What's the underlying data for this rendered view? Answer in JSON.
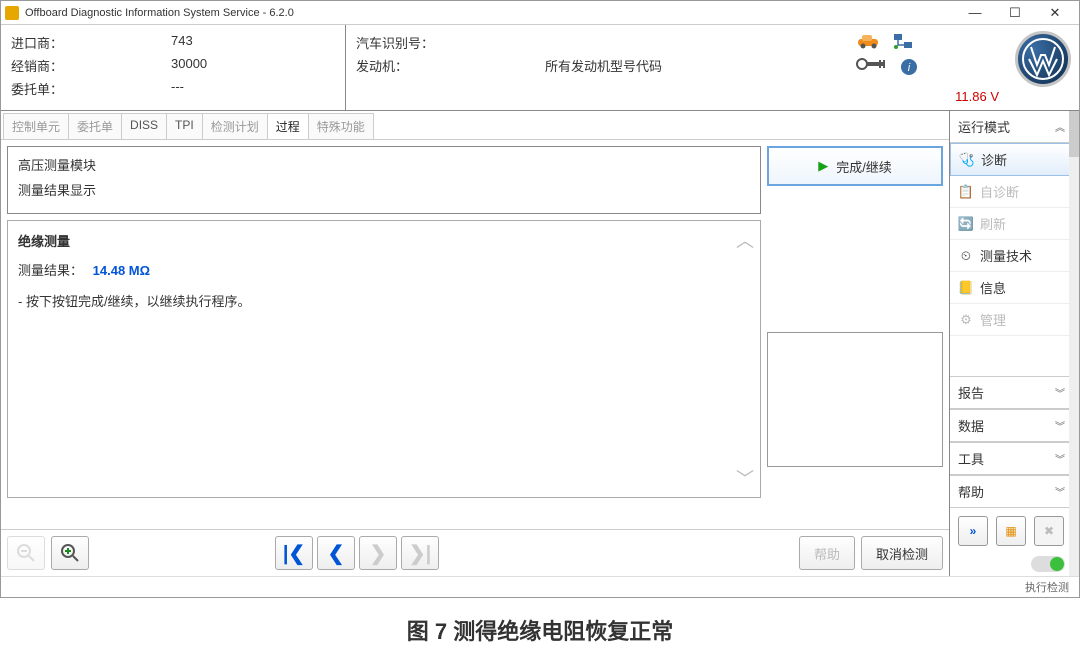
{
  "title": "Offboard Diagnostic Information System Service - 6.2.0",
  "header": {
    "importer_lbl": "进口商：",
    "importer_val": "743",
    "dealer_lbl": "经销商：",
    "dealer_val": "30000",
    "order_lbl": "委托单：",
    "order_val": "---",
    "vin_lbl": "汽车识别号：",
    "vin_val": "",
    "engine_lbl": "发动机：",
    "engine_val": "所有发动机型号代码",
    "voltage": "11.86 V"
  },
  "tabs": {
    "t0": "控制单元",
    "t1": "委托单",
    "t2": "DISS",
    "t3": "TPI",
    "t4": "检测计划",
    "t5": "过程",
    "t6": "特殊功能"
  },
  "panel": {
    "line1": "高压测量模块",
    "line2": "测量结果显示",
    "heading": "绝缘测量",
    "result_lbl": "测量结果：",
    "result_val": "14.48 MΩ",
    "instruction": "- 按下按钮完成/继续，以继续执行程序。"
  },
  "actions": {
    "finish": "完成/继续",
    "help": "帮助",
    "cancel": "取消检测"
  },
  "sidebar": {
    "mode_header": "运行模式",
    "diag": "诊断",
    "selfdiag": "自诊断",
    "flash": "刷新",
    "measure": "测量技术",
    "info": "信息",
    "admin": "管理",
    "report": "报告",
    "data": "数据",
    "tools": "工具",
    "help": "帮助"
  },
  "status": "执行检测",
  "caption": "图 7  测得绝缘电阻恢复正常"
}
